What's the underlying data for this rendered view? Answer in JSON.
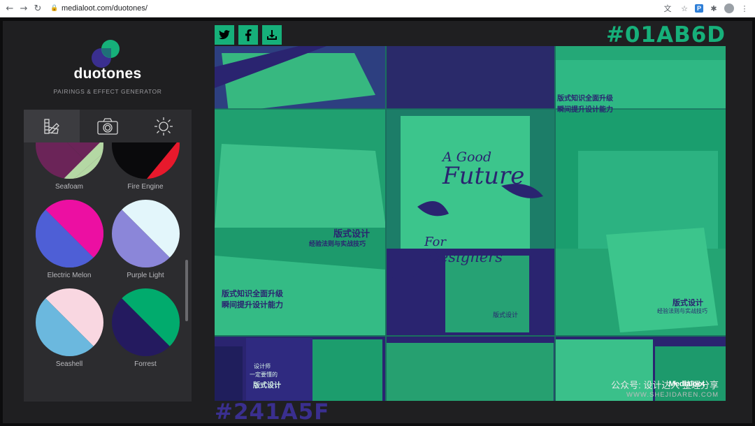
{
  "browser": {
    "url": "medialoot.com/duotones/",
    "back_icon": "←",
    "forward_icon": "→",
    "reload_icon": "↻",
    "lock_icon": "🔒",
    "translate_icon": "文",
    "star_icon": "☆",
    "extension_p": "P",
    "puzzle_icon": "✱",
    "menu_icon": "⋮"
  },
  "sidebar": {
    "brand": "duotones",
    "tagline": "PAIRINGS & EFFECT GENERATOR",
    "tabs": [
      "palette",
      "camera",
      "brightness"
    ],
    "swatches": [
      {
        "name": "Seafoam",
        "colors": [
          "#6b2458",
          "#b4d8a4"
        ]
      },
      {
        "name": "Fire Engine",
        "colors": [
          "#0a0a0c",
          "#e8192c"
        ]
      },
      {
        "name": "Electric Melon",
        "colors": [
          "#4e5fd6",
          "#ec0fa2"
        ]
      },
      {
        "name": "Purple Light",
        "colors": [
          "#8b86d9",
          "#e3f6fb"
        ]
      },
      {
        "name": "Seashell",
        "colors": [
          "#6bb8de",
          "#f9d7e1"
        ]
      },
      {
        "name": "Forrest",
        "colors": [
          "#241a5f",
          "#01ab6d"
        ]
      }
    ]
  },
  "main": {
    "hex_light": "#01AB6D",
    "hex_dark": "#241A5F",
    "share": [
      "twitter",
      "facebook",
      "download"
    ],
    "book_title_1": "A Good",
    "book_title_2": "Future",
    "book_title_3": "For",
    "book_title_4": "Designers",
    "cn_1": "版式设计",
    "cn_2": "经验法则与实战技巧",
    "cn_3": "版式知识全面升级",
    "cn_4": "瞬间提升设计能力",
    "cn_5": "版式知识全面升级",
    "cn_6": "瞬间提升设计能力",
    "cn_7": "版式设计",
    "cn_8": "经验法则与实战技巧",
    "cn_9": "版式设计",
    "cn_10": "设计师",
    "cn_11": "一定要懂的",
    "cn_12": "版式设计",
    "cn_13": "版式设计",
    "watermark_line1": "公众号: 设计达人 整理分享",
    "watermark_line2": "WWW.SHEJIDAREN.COM",
    "credit": "Medialoot"
  }
}
